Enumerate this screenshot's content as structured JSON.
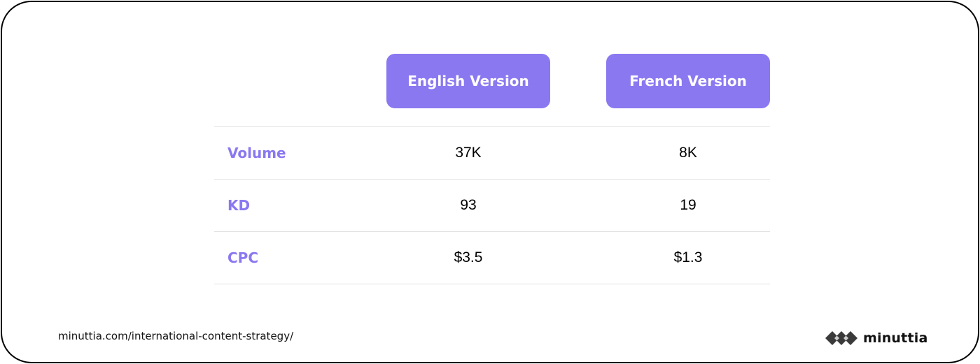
{
  "header": {
    "columns": [
      "English Version",
      "French Version"
    ]
  },
  "table": {
    "rows": [
      {
        "label": "Volume",
        "english": "37K",
        "french": "8K"
      },
      {
        "label": "KD",
        "english": "93",
        "french": "19"
      },
      {
        "label": "CPC",
        "english": "$3.5",
        "french": "$1.3"
      }
    ]
  },
  "footer": {
    "url": "minuttia.com/international-content-strategy/",
    "brand": "minuttia",
    "brand_icon": "diamond-logo-icon"
  },
  "colors": {
    "accent": "#8a78f1",
    "text": "#000000",
    "divider": "#e2e2e2",
    "logo": "#3a3a3a"
  }
}
